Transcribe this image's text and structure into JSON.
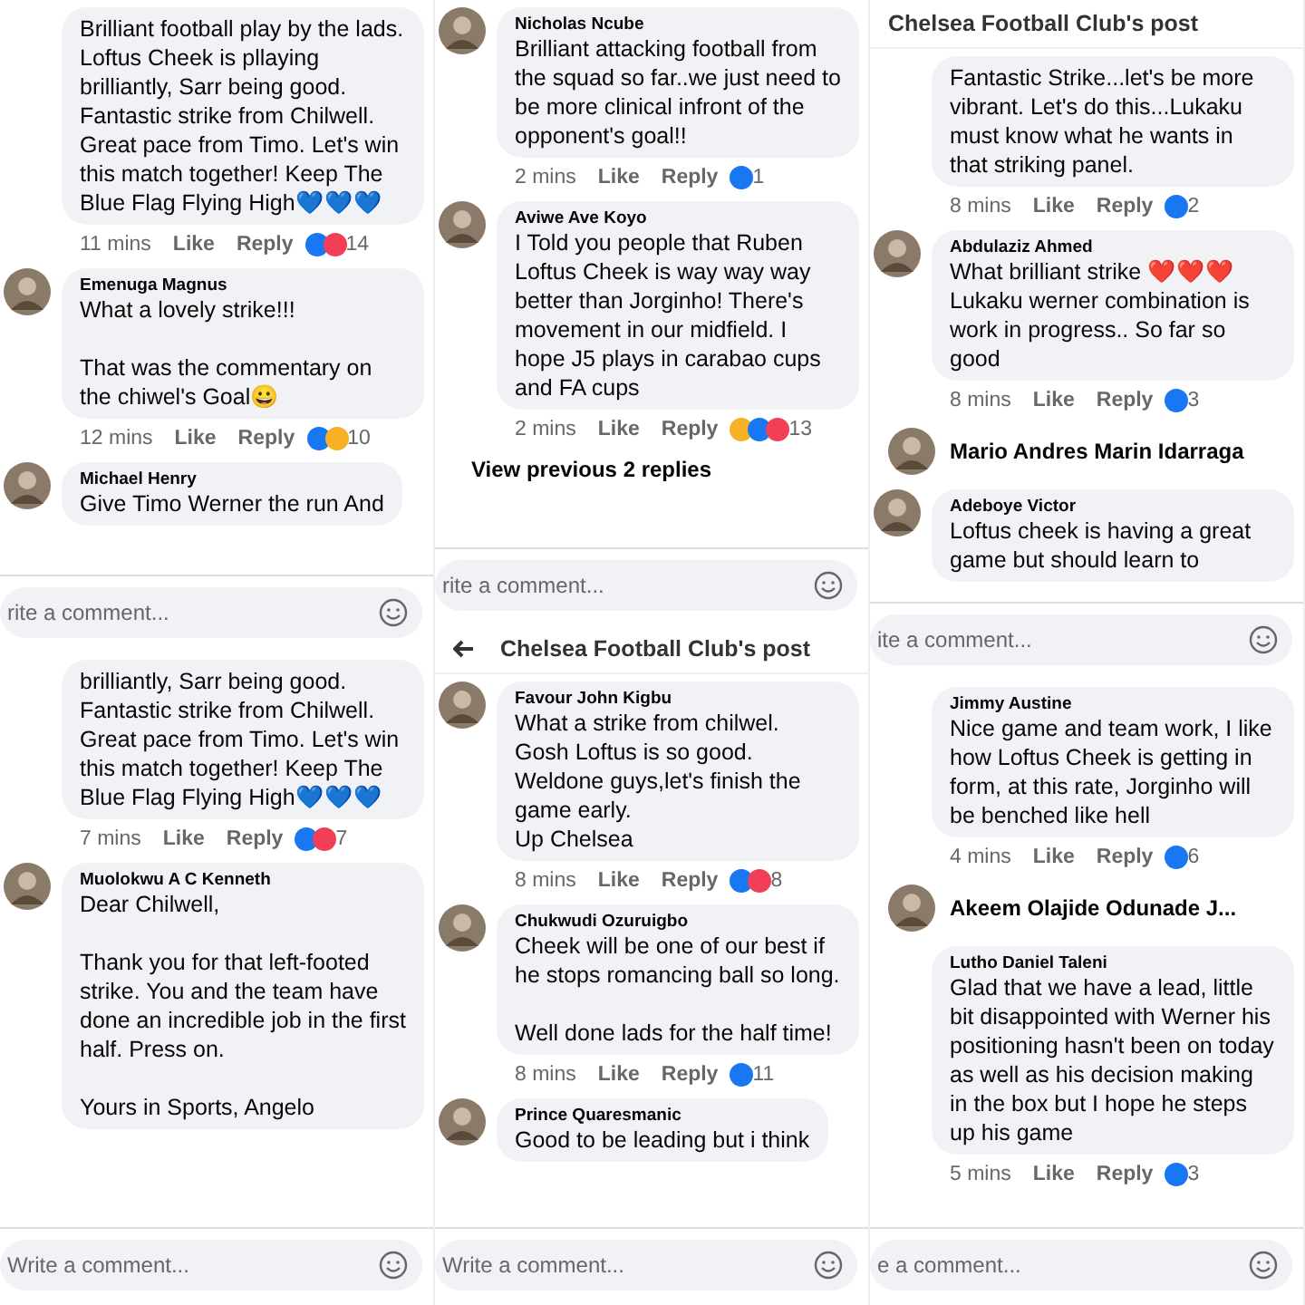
{
  "columns": [
    {
      "panels": [
        {
          "items": [
            {
              "kind": "comment",
              "avatar": false,
              "text": "Brilliant football play by the lads. Loftus Cheek is pllaying brilliantly, Sarr being good. Fantastic strike from Chilwell. Great pace from Timo. Let's win this match together! Keep The Blue Flag Flying High💙💙💙",
              "time": "11 mins",
              "like": "Like",
              "reply": "Reply",
              "reactions": [
                {
                  "color": "#1877f2"
                },
                {
                  "color": "#f33e58"
                }
              ],
              "count": "14"
            },
            {
              "kind": "comment",
              "avatar": true,
              "name": "Emenuga Magnus",
              "text": "What a lovely strike!!!\n\nThat was the commentary on the chiwel's Goal😀",
              "time": "12 mins",
              "like": "Like",
              "reply": "Reply",
              "reactions": [
                {
                  "color": "#1877f2"
                },
                {
                  "color": "#f7b125"
                }
              ],
              "count": "10"
            },
            {
              "kind": "comment",
              "avatar": true,
              "name": "Michael Henry",
              "text": "Give Timo Werner the run And"
            }
          ],
          "composer": {
            "placeholder": "rite a comment..."
          }
        },
        {
          "items": [
            {
              "kind": "comment",
              "avatar": false,
              "text": "brilliantly, Sarr being good. Fantastic strike from Chilwell. Great pace from Timo. Let's win this match together! Keep The Blue Flag Flying High💙💙💙",
              "time": "7 mins",
              "like": "Like",
              "reply": "Reply",
              "reactions": [
                {
                  "color": "#1877f2"
                },
                {
                  "color": "#f33e58"
                }
              ],
              "count": "7"
            },
            {
              "kind": "comment",
              "avatar": true,
              "name": "Muolokwu A C Kenneth",
              "text": "Dear Chilwell,\n\nThank you for that left-footed strike. You and the team have done an incredible job in the first half. Press on.\n\nYours in Sports, Angelo"
            }
          ],
          "composer": {
            "placeholder": "Write a comment..."
          }
        }
      ]
    },
    {
      "panels": [
        {
          "items": [
            {
              "kind": "comment",
              "avatar": true,
              "name": "Nicholas Ncube",
              "text": "Brilliant attacking football from the squad so far..we just need to be more clinical infront of the opponent's goal!!",
              "time": "2 mins",
              "like": "Like",
              "reply": "Reply",
              "reactions": [
                {
                  "color": "#1877f2"
                }
              ],
              "count": "1"
            },
            {
              "kind": "comment",
              "avatar": true,
              "name": "Aviwe Ave Koyo",
              "text": "I Told you people that Ruben Loftus Cheek is way way way better than Jorginho! There's movement in our midfield. I hope J5 plays in carabao cups and FA cups",
              "time": "2 mins",
              "like": "Like",
              "reply": "Reply",
              "reactions": [
                {
                  "color": "#f7b125"
                },
                {
                  "color": "#1877f2"
                },
                {
                  "color": "#f33e58"
                }
              ],
              "count": "13"
            },
            {
              "kind": "link",
              "text": "View previous 2 replies"
            }
          ],
          "composer": {
            "placeholder": "rite a comment..."
          }
        },
        {
          "header": {
            "title": "Chelsea Football Club's post",
            "back_arrow": true
          },
          "items": [
            {
              "kind": "comment",
              "avatar": true,
              "name": "Favour John Kigbu",
              "text": "What a strike from chilwel.\nGosh Loftus is so good.\nWeldone guys,let's finish the game early.\nUp Chelsea",
              "time": "8 mins",
              "like": "Like",
              "reply": "Reply",
              "reactions": [
                {
                  "color": "#1877f2"
                },
                {
                  "color": "#f33e58"
                }
              ],
              "count": "8"
            },
            {
              "kind": "comment",
              "avatar": true,
              "name": "Chukwudi Ozuruigbo",
              "text": "Cheek will be one of our best if he stops romancing ball so long.\n\nWell done lads for the half time!",
              "time": "8 mins",
              "like": "Like",
              "reply": "Reply",
              "reactions": [
                {
                  "color": "#1877f2"
                }
              ],
              "count": "11"
            },
            {
              "kind": "comment",
              "avatar": true,
              "name": "Prince Quaresmanic",
              "text": "Good to be leading but i think"
            }
          ],
          "composer": {
            "placeholder": "Write a comment..."
          }
        }
      ]
    },
    {
      "panels": [
        {
          "header": {
            "title": "Chelsea Football Club's post",
            "back_arrow": false
          },
          "items": [
            {
              "kind": "comment",
              "avatar": false,
              "text": "Fantastic Strike...let's be more vibrant. Let's do this...Lukaku must know what he wants in that striking panel.",
              "time": "8 mins",
              "like": "Like",
              "reply": "Reply",
              "reactions": [
                {
                  "color": "#1877f2"
                }
              ],
              "count": "2"
            },
            {
              "kind": "comment",
              "avatar": true,
              "name": "Abdulaziz Ahmed",
              "text": "What brilliant strike ❤️❤️❤️ Lukaku werner combination is work in progress.. So far so good",
              "time": "8 mins",
              "like": "Like",
              "reply": "Reply",
              "reactions": [
                {
                  "color": "#1877f2"
                }
              ],
              "count": "3"
            },
            {
              "kind": "author_line",
              "name": "Mario Andres Marin Idarraga"
            },
            {
              "kind": "comment",
              "avatar": true,
              "name": "Adeboye Victor",
              "text": "Loftus cheek is having a great game but should learn to"
            }
          ],
          "composer": {
            "placeholder": "ite a comment..."
          }
        },
        {
          "items": [
            {
              "kind": "comment",
              "avatar": false,
              "name": "Jimmy Austine",
              "text": "Nice game and team work, I like how Loftus Cheek is getting in form, at this rate, Jorginho will be benched like hell",
              "time": "4 mins",
              "like": "Like",
              "reply": "Reply",
              "reactions": [
                {
                  "color": "#1877f2"
                }
              ],
              "count": "6"
            },
            {
              "kind": "author_line",
              "name": "Akeem Olajide Odunade  J..."
            },
            {
              "kind": "comment",
              "avatar": false,
              "name": "Lutho Daniel Taleni",
              "text": "Glad that we have a lead, little bit disappointed with Werner his positioning hasn't been on today as well as his decision making in the box but I hope he steps up his game",
              "time": "5 mins",
              "like": "Like",
              "reply": "Reply",
              "reactions": [
                {
                  "color": "#1877f2"
                }
              ],
              "count": "3"
            }
          ],
          "composer": {
            "placeholder": "e a comment..."
          }
        }
      ]
    }
  ]
}
